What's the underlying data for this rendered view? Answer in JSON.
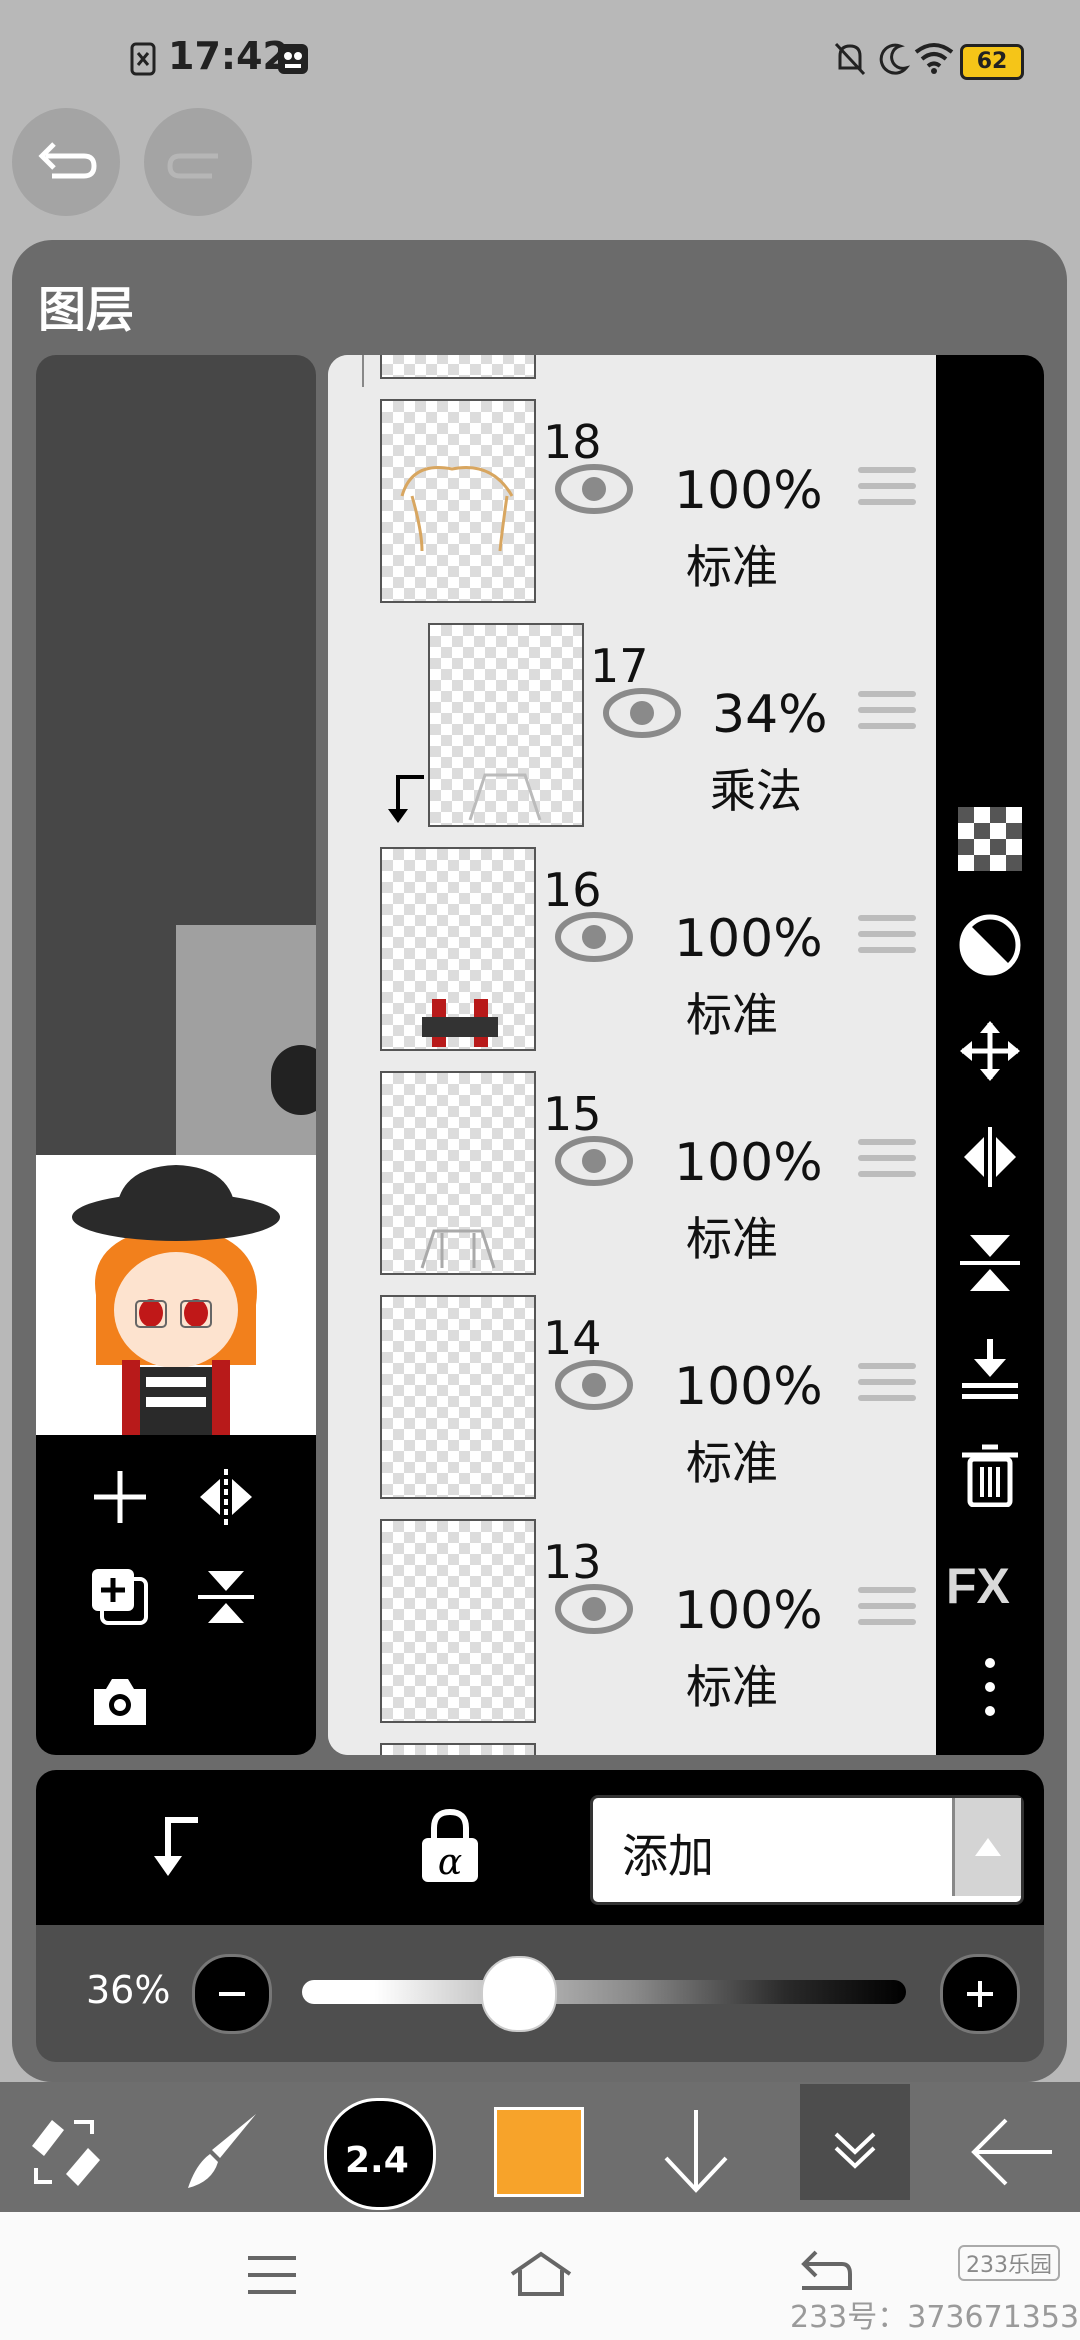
{
  "status": {
    "time": "17:42",
    "battery": "62"
  },
  "panel": {
    "title": "图层"
  },
  "layers": [
    {
      "num": "18",
      "opacity": "100%",
      "mode": "标准"
    },
    {
      "num": "17",
      "opacity": "34%",
      "mode": "乘法"
    },
    {
      "num": "16",
      "opacity": "100%",
      "mode": "标准"
    },
    {
      "num": "15",
      "opacity": "100%",
      "mode": "标准"
    },
    {
      "num": "14",
      "opacity": "100%",
      "mode": "标准"
    },
    {
      "num": "13",
      "opacity": "100%",
      "mode": "标准"
    }
  ],
  "right_toolbar": {
    "fx_label": "FX"
  },
  "blend": {
    "mode": "添加"
  },
  "opacity": {
    "label": "36%",
    "value": 0.36
  },
  "brush": {
    "size": "2.4"
  },
  "colors": {
    "current": "#f7a32a"
  },
  "watermark": {
    "text": "233号：373671353",
    "logo": "233乐园"
  },
  "icons": [
    "undo-icon",
    "redo-icon",
    "eye-icon",
    "drag-handle-icon",
    "checker-icon",
    "circle-half-icon",
    "move-icon",
    "flip-horizontal-icon",
    "flip-vertical-icon",
    "merge-down-icon",
    "trash-icon",
    "more-icon",
    "add-layer-icon",
    "duplicate-icon",
    "camera-icon",
    "clip-arrow-icon",
    "alpha-lock-icon",
    "minus-icon",
    "plus-icon",
    "brush-icon",
    "swap-icon",
    "down-arrow-icon",
    "chevron-down-icon",
    "back-arrow-icon",
    "menu-icon",
    "home-icon",
    "return-icon"
  ]
}
